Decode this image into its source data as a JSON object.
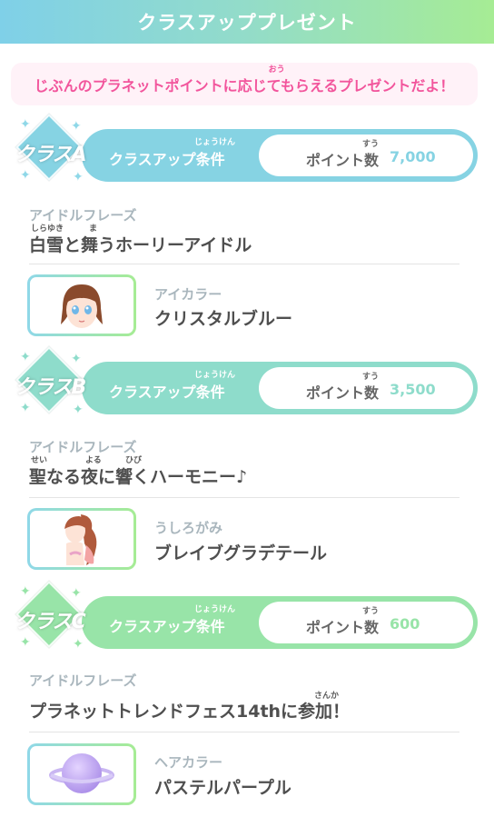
{
  "header": {
    "title": "クラスアッププレゼント"
  },
  "notice": {
    "text": "じぶんのプラネットポイントに応じてもらえるプレゼントだよ！",
    "ruby": "おう"
  },
  "common": {
    "condition_label": "クラスアップ条件",
    "condition_ruby": "じょうけん",
    "points_label": "ポイント数",
    "points_ruby": "すう",
    "phrase_category": "アイドルフレーズ"
  },
  "classes": [
    {
      "label": "クラスA",
      "color": "#86d3e3",
      "points": "7,000",
      "phrase": "白雪と舞うホーリーアイドル",
      "phrase_ruby": [
        "しらゆき",
        "ま"
      ],
      "item_category": "アイカラー",
      "item_name": "クリスタルブルー",
      "item_icon": "eye-face-icon"
    },
    {
      "label": "クラスB",
      "color": "#8edccb",
      "points": "3,500",
      "phrase": "聖なる夜に響くハーモニー♪",
      "phrase_ruby": [
        "せい",
        "よる",
        "ひび"
      ],
      "item_category": "うしろがみ",
      "item_name": "ブレイブグラデテール",
      "item_icon": "ponytail-hair-icon"
    },
    {
      "label": "クラスC",
      "color": "#98e4a8",
      "points": "600",
      "phrase": "プラネットトレンドフェス14thに参加！",
      "phrase_ruby": [
        "さんか"
      ],
      "item_category": "ヘアカラー",
      "item_name": "パステルパープル",
      "item_icon": "purple-planet-icon"
    }
  ]
}
